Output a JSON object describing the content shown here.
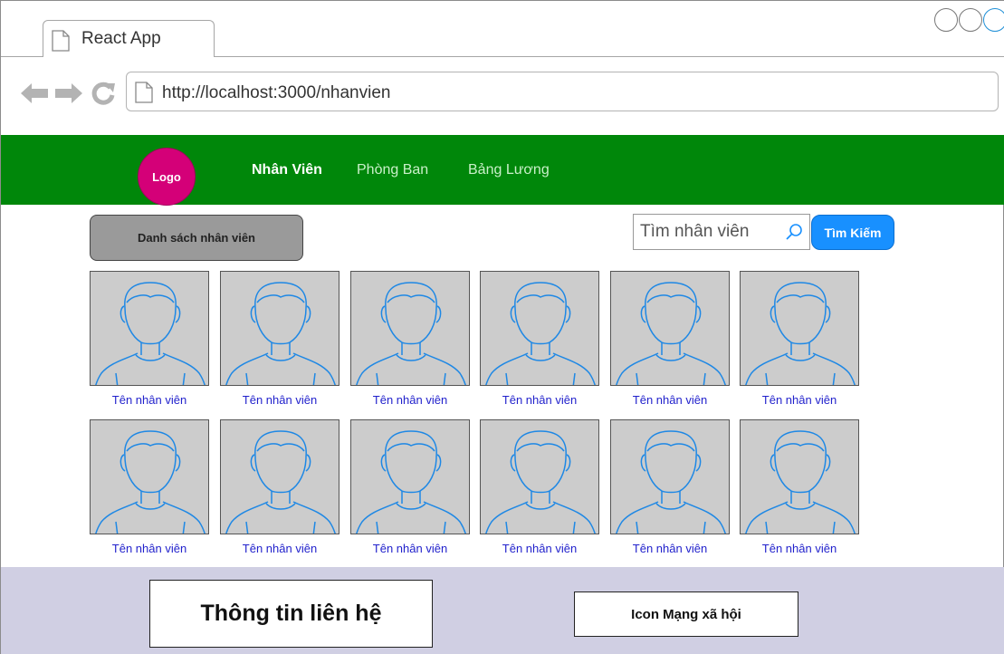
{
  "browser": {
    "tab_title": "React App",
    "url": "http://localhost:3000/nhanvien"
  },
  "navbar": {
    "logo_label": "Logo",
    "links": [
      {
        "label": "Nhân Viên",
        "active": true
      },
      {
        "label": "Phòng Ban",
        "active": false
      },
      {
        "label": "Bảng Lương",
        "active": false
      }
    ],
    "colors": {
      "background": "#00870a",
      "logo": "#d40078"
    }
  },
  "main": {
    "list_button_label": "Danh sách nhân viên",
    "search": {
      "placeholder": "Tìm nhân viên",
      "button_label": "Tìm Kiếm"
    },
    "employees": [
      {
        "name": "Tên nhân viên"
      },
      {
        "name": "Tên nhân viên"
      },
      {
        "name": "Tên nhân viên"
      },
      {
        "name": "Tên nhân viên"
      },
      {
        "name": "Tên nhân viên"
      },
      {
        "name": "Tên nhân viên"
      },
      {
        "name": "Tên nhân viên"
      },
      {
        "name": "Tên nhân viên"
      },
      {
        "name": "Tên nhân viên"
      },
      {
        "name": "Tên nhân viên"
      },
      {
        "name": "Tên nhân viên"
      },
      {
        "name": "Tên nhân viên"
      }
    ]
  },
  "footer": {
    "contact_label": "Thông tin liên hệ",
    "social_label": "Icon Mạng xã hội"
  }
}
